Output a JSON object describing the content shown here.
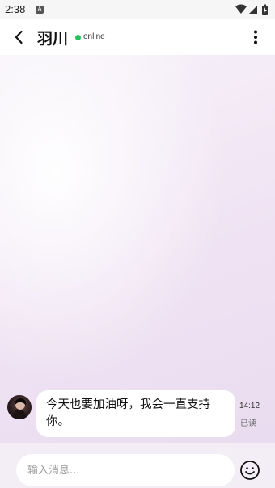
{
  "status_bar": {
    "time": "2:38",
    "notification_letter": "A",
    "icons": [
      "wifi-icon",
      "signal-icon",
      "battery-icon"
    ]
  },
  "header": {
    "title": "羽川",
    "status": "online",
    "status_color": "#26c15a",
    "icons": {
      "back": "back-arrow-icon",
      "more": "more-vertical-icon"
    }
  },
  "messages": [
    {
      "sender": "other",
      "text": "今天也要加油呀，我会一直支持你。",
      "time": "14:12",
      "read_status": "已读"
    }
  ],
  "input": {
    "placeholder": "输入消息...",
    "value": "",
    "emoji_icon": "emoji-icon"
  }
}
